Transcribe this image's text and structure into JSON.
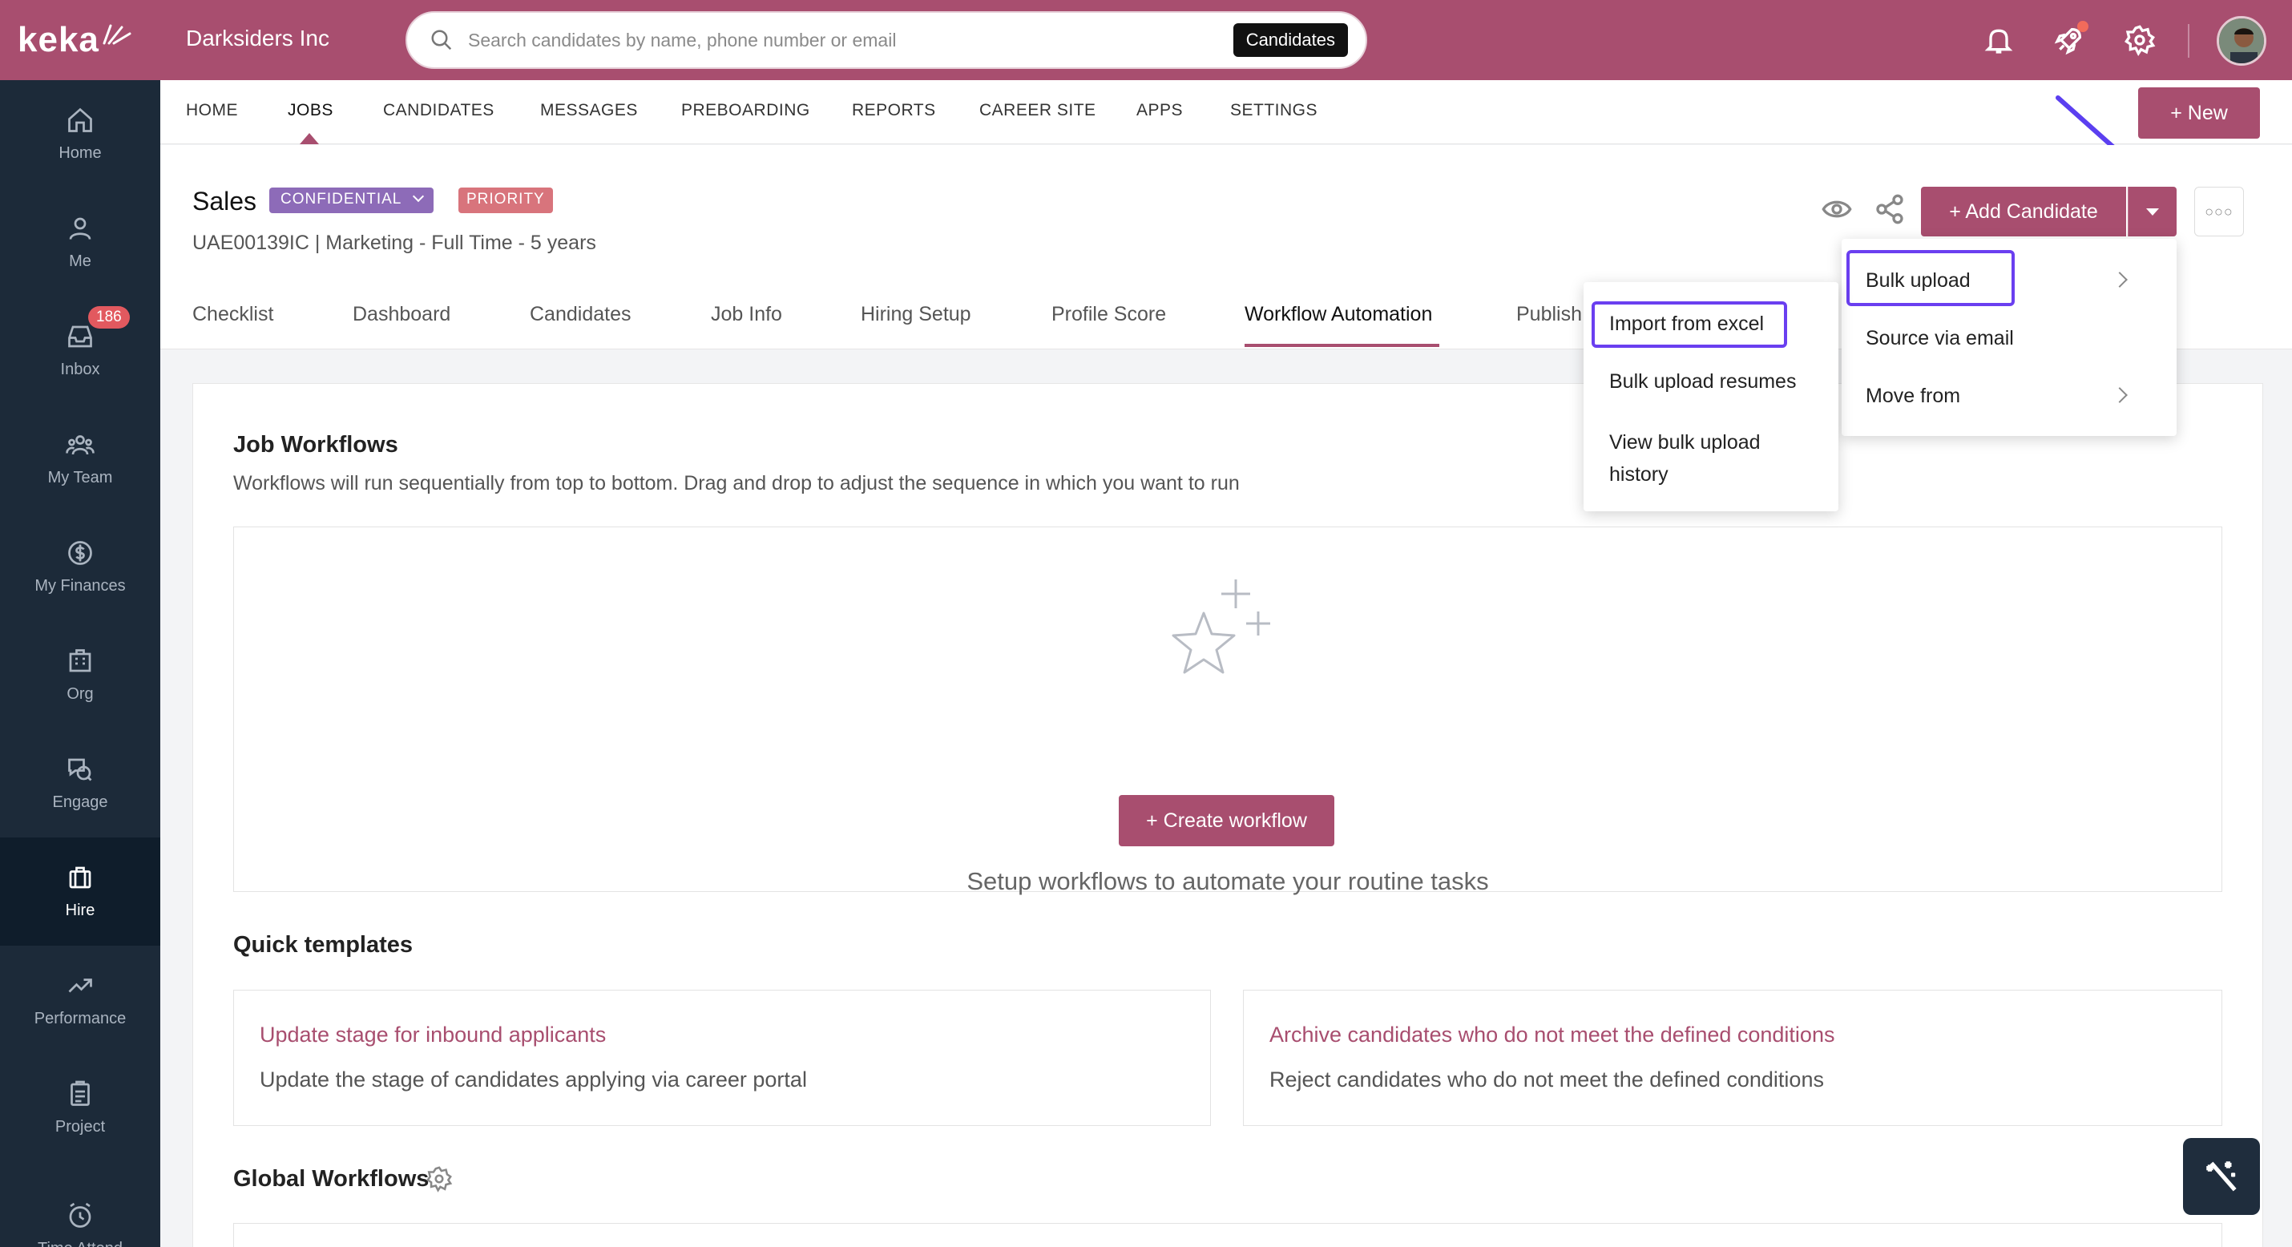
{
  "brand": {
    "logo_text": "keka",
    "accent": "#a84e6f",
    "sidebar_bg": "#1c2a39"
  },
  "sidebar": {
    "items": [
      {
        "label": "Home",
        "icon": "home-icon"
      },
      {
        "label": "Me",
        "icon": "user-icon"
      },
      {
        "label": "Inbox",
        "icon": "inbox-icon",
        "badge": "186"
      },
      {
        "label": "My Team",
        "icon": "team-icon"
      },
      {
        "label": "My Finances",
        "icon": "dollar-icon"
      },
      {
        "label": "Org",
        "icon": "org-icon"
      },
      {
        "label": "Engage",
        "icon": "engage-icon"
      },
      {
        "label": "Hire",
        "icon": "briefcase-icon",
        "active": true
      },
      {
        "label": "Performance",
        "icon": "trend-icon"
      },
      {
        "label": "Project",
        "icon": "clipboard-icon"
      },
      {
        "label": "Time Attend",
        "icon": "clock-icon"
      }
    ]
  },
  "header": {
    "company": "Darksiders Inc",
    "search_placeholder": "Search candidates by name, phone number or email",
    "search_scope": "Candidates"
  },
  "topnav": {
    "links": [
      "HOME",
      "JOBS",
      "CANDIDATES",
      "MESSAGES",
      "PREBOARDING",
      "REPORTS",
      "CAREER SITE",
      "APPS",
      "SETTINGS"
    ],
    "active": "JOBS",
    "new_button": "+ New"
  },
  "job": {
    "title": "Sales",
    "confidential_badge": "CONFIDENTIAL",
    "priority_badge": "PRIORITY",
    "subtitle": "UAE00139IC | Marketing - Full Time - 5 years",
    "add_candidate": "+ Add Candidate",
    "tabs": [
      "Checklist",
      "Dashboard",
      "Candidates",
      "Job Info",
      "Hiring Setup",
      "Profile Score",
      "Workflow Automation",
      "Publish"
    ],
    "active_tab": "Workflow Automation"
  },
  "add_menu": {
    "items": [
      "Bulk upload",
      "Source via email",
      "Move from"
    ],
    "highlighted": "Bulk upload"
  },
  "bulk_submenu": {
    "items": [
      "Import from excel",
      "Bulk upload resumes",
      "View bulk upload history"
    ],
    "highlighted": "Import from excel"
  },
  "workflows": {
    "title": "Job Workflows",
    "description": "Workflows will run sequentially from top to bottom. Drag and drop to adjust the sequence in which you want to run",
    "empty_text": "Setup workflows to automate your routine tasks",
    "create_button": "+ Create workflow",
    "quick_title": "Quick templates",
    "templates": [
      {
        "title": "Update stage for inbound applicants",
        "desc": "Update the stage of candidates applying via career portal"
      },
      {
        "title": "Archive candidates who do not meet the defined conditions",
        "desc": "Reject candidates who do not meet the defined conditions"
      }
    ],
    "global_title": "Global Workflows"
  }
}
